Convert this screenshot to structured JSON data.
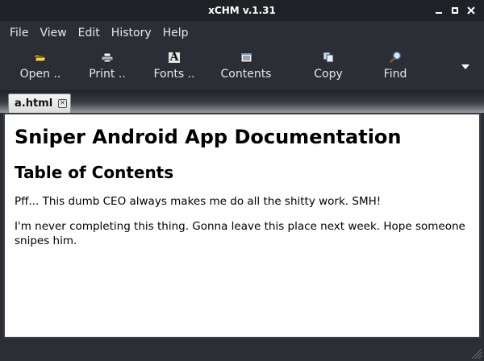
{
  "window": {
    "title": "xCHM v.1.31"
  },
  "menu": {
    "items": [
      "File",
      "View",
      "Edit",
      "History",
      "Help"
    ]
  },
  "toolbar": {
    "buttons": [
      {
        "label": "Open ..",
        "icon": "open-folder-icon"
      },
      {
        "label": "Print ..",
        "icon": "printer-icon"
      },
      {
        "label": "Fonts ..",
        "icon": "font-icon"
      },
      {
        "label": "Contents",
        "icon": "contents-icon"
      },
      {
        "label": "Copy",
        "icon": "copy-icon"
      },
      {
        "label": "Find",
        "icon": "find-icon"
      }
    ],
    "overflow_icon": "chevron-down-icon"
  },
  "tabs": [
    {
      "label": "a.html",
      "close_icon": "close-icon"
    }
  ],
  "document": {
    "heading": "Sniper Android App Documentation",
    "subheading": "Table of Contents",
    "paragraphs": [
      "Pff... This dumb CEO always makes me do all the shitty work. SMH!",
      "I'm never completing this thing. Gonna leave this place next week. Hope someone snipes him."
    ]
  },
  "colors": {
    "titlebar_bg": "#1f2126",
    "window_bg": "#2b2e35",
    "content_bg": "#ffffff",
    "text_light": "#e8e8e8"
  }
}
